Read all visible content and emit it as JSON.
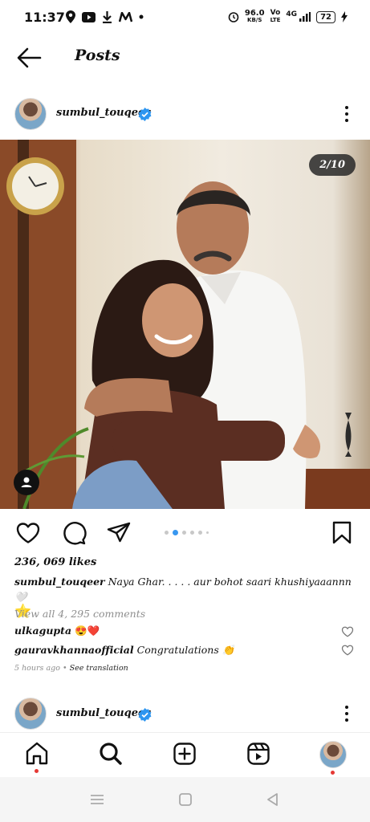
{
  "status": {
    "time": "11:37",
    "net_speed_value": "96.0",
    "net_speed_unit": "KB/S",
    "volte_top": "Vo",
    "volte_bottom": "LTE",
    "network": "4G",
    "battery": "72"
  },
  "header": {
    "title": "Posts"
  },
  "post": {
    "username": "sumbul_touqeer",
    "counter": "2/10",
    "likes": "236, 069 likes",
    "caption_user": "sumbul_touqeer",
    "caption_text": "Naya Ghar. . . . . aur bohot saari khushiyaaannn🤍",
    "caption_emoji": "⭐",
    "view_comments": "View all 4, 295 comments",
    "comments": [
      {
        "user": "ulkagupta",
        "text": "😍❤️"
      },
      {
        "user": "gauravkhannaofficial",
        "text": "Congratulations 👏"
      }
    ],
    "time_ago": "5 hours ago",
    "see_translation": "See translation"
  },
  "next_post": {
    "username": "sumbul_touqeer"
  },
  "icons": {
    "back": "arrow-left-icon",
    "verified": "verified-badge-icon",
    "more": "kebab-icon",
    "like": "heart-icon",
    "comment": "comment-icon",
    "share": "send-icon",
    "save": "bookmark-icon",
    "home": "home-icon",
    "search": "search-icon",
    "create": "plus-square-icon",
    "reels": "reels-icon"
  },
  "colors": {
    "accent": "#3897f0",
    "verified": "#2d95f0",
    "notification": "#e53935"
  }
}
